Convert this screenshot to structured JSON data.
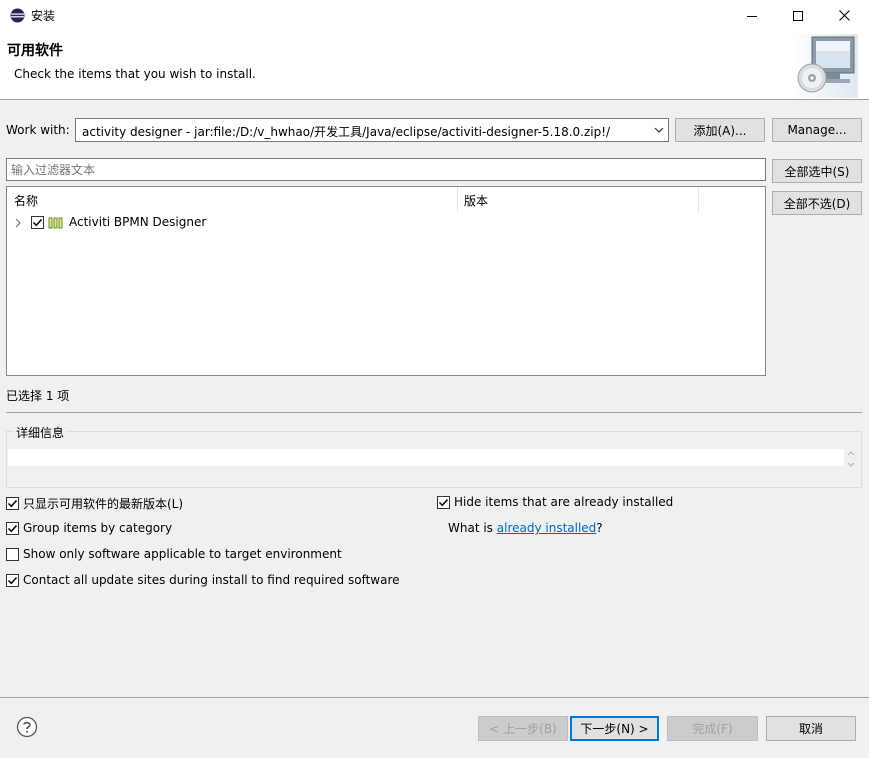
{
  "window": {
    "title": "安装"
  },
  "header": {
    "title": "可用软件",
    "description": "Check the items that you wish to install."
  },
  "work_with": {
    "label": "Work with:",
    "value": "activity designer - jar:file:/D:/v_hwhao/开发工具/Java/eclipse/activiti-designer-5.18.0.zip!/",
    "add_label": "添加(A)...",
    "manage_label": "Manage..."
  },
  "filter": {
    "placeholder": "输入过滤器文本"
  },
  "side_buttons": {
    "select_all": "全部选中(S)",
    "deselect_all": "全部不选(D)"
  },
  "table": {
    "columns": [
      "名称",
      "版本"
    ],
    "rows": [
      {
        "name": "Activiti BPMN Designer",
        "version": "",
        "checked": true
      }
    ]
  },
  "selection_status": "已选择 1 项",
  "details": {
    "label": "详细信息"
  },
  "options": {
    "latest_only": {
      "label": "只显示可用软件的最新版本(L)",
      "checked": true
    },
    "group_by_category": {
      "label": "Group items by category",
      "checked": true
    },
    "target_env": {
      "label": "Show only software applicable to target environment",
      "checked": false
    },
    "contact_sites": {
      "label": "Contact all update sites during install to find required software",
      "checked": true
    },
    "hide_installed": {
      "label": "Hide items that are already installed",
      "checked": true
    },
    "what_is_prefix": "What is ",
    "what_is_link": "already installed",
    "what_is_suffix": "?"
  },
  "footer": {
    "back_label": "< 上一步(B)",
    "next_label": "下一步(N) >",
    "finish_label": "完成(F)",
    "cancel_label": "取消"
  },
  "colors": {
    "link": "#0066cc",
    "default_button_border": "#0078d7"
  }
}
